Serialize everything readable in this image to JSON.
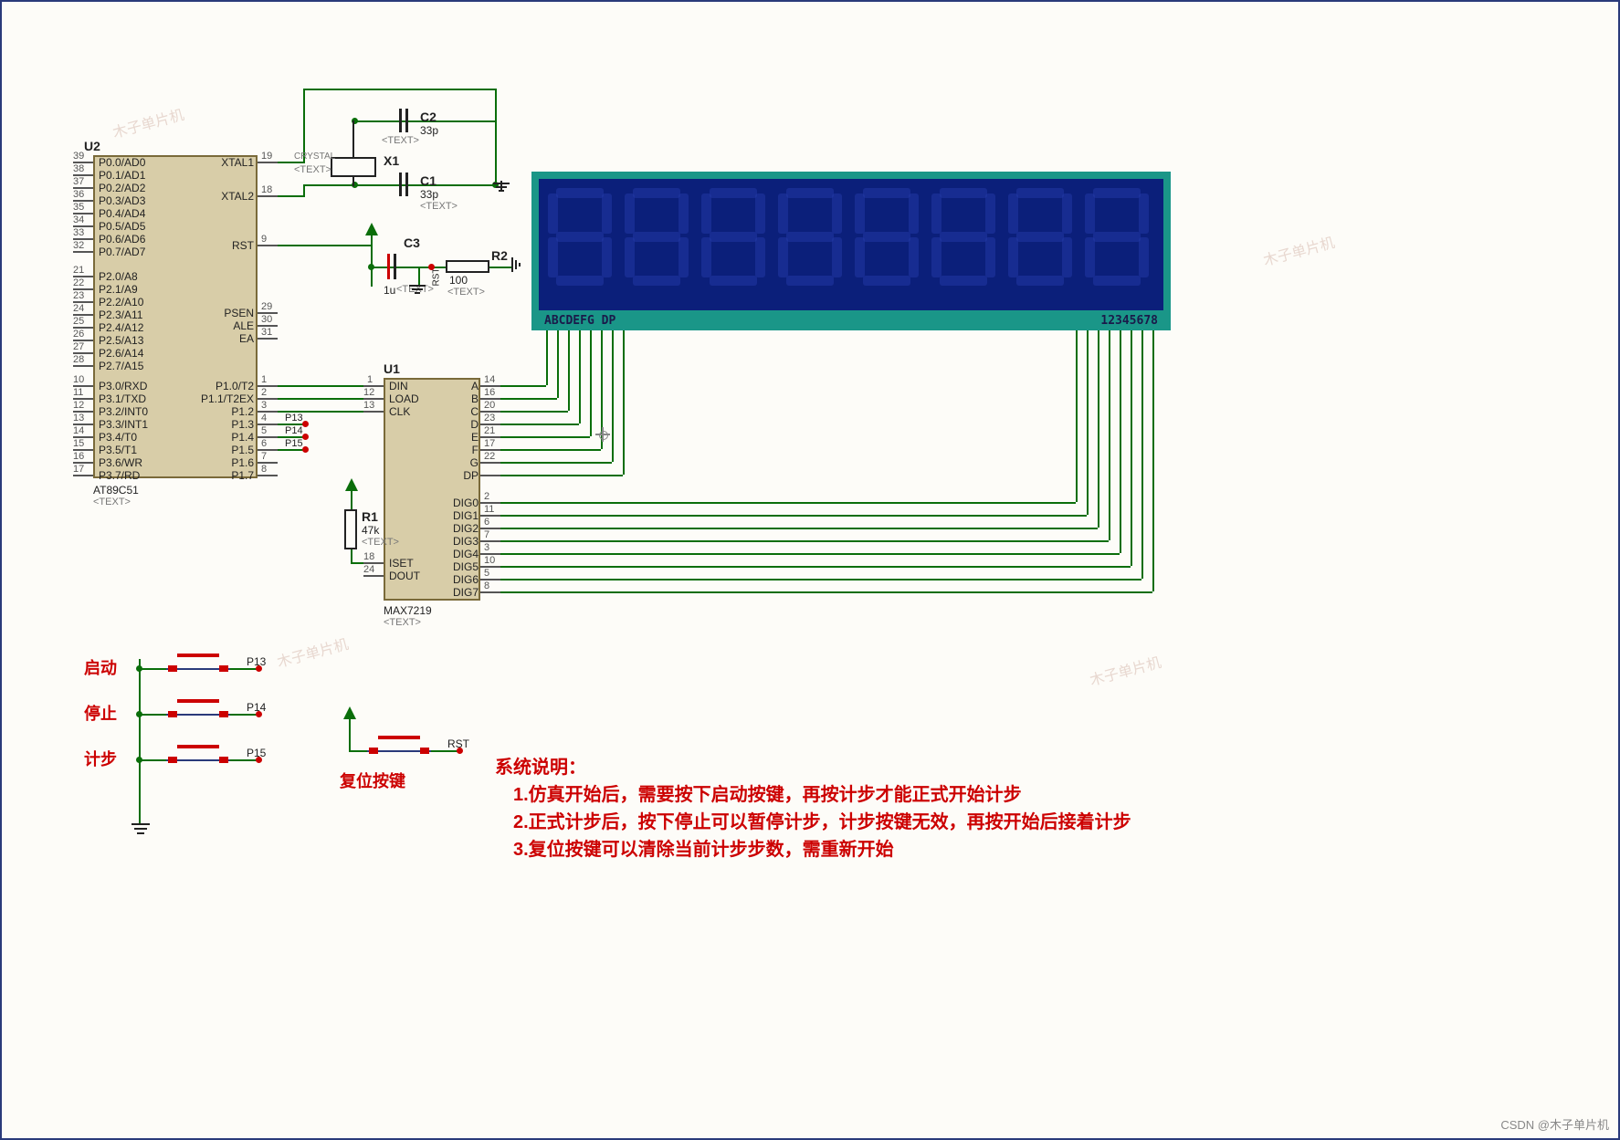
{
  "mcu": {
    "ref": "U2",
    "part": "AT89C51",
    "text": "<TEXT>",
    "left_pins": [
      {
        "num": "39",
        "label": "P0.0/AD0"
      },
      {
        "num": "38",
        "label": "P0.1/AD1"
      },
      {
        "num": "37",
        "label": "P0.2/AD2"
      },
      {
        "num": "36",
        "label": "P0.3/AD3"
      },
      {
        "num": "35",
        "label": "P0.4/AD4"
      },
      {
        "num": "34",
        "label": "P0.5/AD5"
      },
      {
        "num": "33",
        "label": "P0.6/AD6"
      },
      {
        "num": "32",
        "label": "P0.7/AD7"
      },
      {
        "num": "21",
        "label": "P2.0/A8"
      },
      {
        "num": "22",
        "label": "P2.1/A9"
      },
      {
        "num": "23",
        "label": "P2.2/A10"
      },
      {
        "num": "24",
        "label": "P2.3/A11"
      },
      {
        "num": "25",
        "label": "P2.4/A12"
      },
      {
        "num": "26",
        "label": "P2.5/A13"
      },
      {
        "num": "27",
        "label": "P2.6/A14"
      },
      {
        "num": "28",
        "label": "P2.7/A15"
      },
      {
        "num": "10",
        "label": "P3.0/RXD"
      },
      {
        "num": "11",
        "label": "P3.1/TXD"
      },
      {
        "num": "12",
        "label": "P3.2/INT0"
      },
      {
        "num": "13",
        "label": "P3.3/INT1"
      },
      {
        "num": "14",
        "label": "P3.4/T0"
      },
      {
        "num": "15",
        "label": "P3.5/T1"
      },
      {
        "num": "16",
        "label": "P3.6/WR"
      },
      {
        "num": "17",
        "label": "P3.7/RD"
      }
    ],
    "right_pins": [
      {
        "num": "19",
        "label": "XTAL1"
      },
      {
        "num": "18",
        "label": "XTAL2"
      },
      {
        "num": "9",
        "label": "RST"
      },
      {
        "num": "29",
        "label": "PSEN"
      },
      {
        "num": "30",
        "label": "ALE"
      },
      {
        "num": "31",
        "label": "EA"
      },
      {
        "num": "1",
        "label": "P1.0/T2"
      },
      {
        "num": "2",
        "label": "P1.1/T2EX"
      },
      {
        "num": "3",
        "label": "P1.2"
      },
      {
        "num": "4",
        "label": "P1.3"
      },
      {
        "num": "5",
        "label": "P1.4"
      },
      {
        "num": "6",
        "label": "P1.5"
      },
      {
        "num": "7",
        "label": "P1.6"
      },
      {
        "num": "8",
        "label": "P1.7"
      }
    ]
  },
  "driver": {
    "ref": "U1",
    "part": "MAX7219",
    "text": "<TEXT>",
    "left_pins": [
      {
        "num": "1",
        "label": "DIN"
      },
      {
        "num": "12",
        "label": "LOAD"
      },
      {
        "num": "13",
        "label": "CLK"
      },
      {
        "num": "18",
        "label": "ISET"
      },
      {
        "num": "24",
        "label": "DOUT"
      }
    ],
    "right_seg_pins": [
      {
        "num": "14",
        "label": "A"
      },
      {
        "num": "16",
        "label": "B"
      },
      {
        "num": "20",
        "label": "C"
      },
      {
        "num": "23",
        "label": "D"
      },
      {
        "num": "21",
        "label": "E"
      },
      {
        "num": "17",
        "label": "F"
      },
      {
        "num": "22",
        "label": "G"
      },
      {
        "num": "",
        "label": "DP"
      }
    ],
    "right_dig_pins": [
      {
        "num": "2",
        "label": "DIG0"
      },
      {
        "num": "11",
        "label": "DIG1"
      },
      {
        "num": "6",
        "label": "DIG2"
      },
      {
        "num": "7",
        "label": "DIG3"
      },
      {
        "num": "3",
        "label": "DIG4"
      },
      {
        "num": "10",
        "label": "DIG5"
      },
      {
        "num": "5",
        "label": "DIG6"
      },
      {
        "num": "8",
        "label": "DIG7"
      }
    ]
  },
  "passives": {
    "x1": {
      "ref": "X1",
      "val": "CRYSTAL",
      "text": "<TEXT>"
    },
    "c1": {
      "ref": "C1",
      "val": "33p",
      "text": "<TEXT>"
    },
    "c2": {
      "ref": "C2",
      "val": "33p",
      "text": "<TEXT>"
    },
    "c3": {
      "ref": "C3",
      "val": "1u",
      "text": "<TEXT>"
    },
    "r1": {
      "ref": "R1",
      "val": "47k",
      "text": "<TEXT>"
    },
    "r2": {
      "ref": "R2",
      "val": "100",
      "text": "<TEXT>"
    }
  },
  "netlabels": {
    "p13": "P13",
    "p14": "P14",
    "p15": "P15",
    "rst": "RST"
  },
  "display": {
    "left_label": "ABCDEFG DP",
    "right_label": "12345678"
  },
  "buttons": {
    "start": "启动",
    "stop": "停止",
    "step": "计步",
    "reset": "复位按键",
    "p13": "P13",
    "p14": "P14",
    "p15": "P15",
    "rst": "RST"
  },
  "description": {
    "title": "系统说明：",
    "l1": "1.仿真开始后，需要按下启动按键，再按计步才能正式开始计步",
    "l2": "2.正式计步后，按下停止可以暂停计步，计步按键无效，再按开始后接着计步",
    "l3": "3.复位按键可以清除当前计步步数，需重新开始"
  },
  "footer": "CSDN @木子单片机"
}
